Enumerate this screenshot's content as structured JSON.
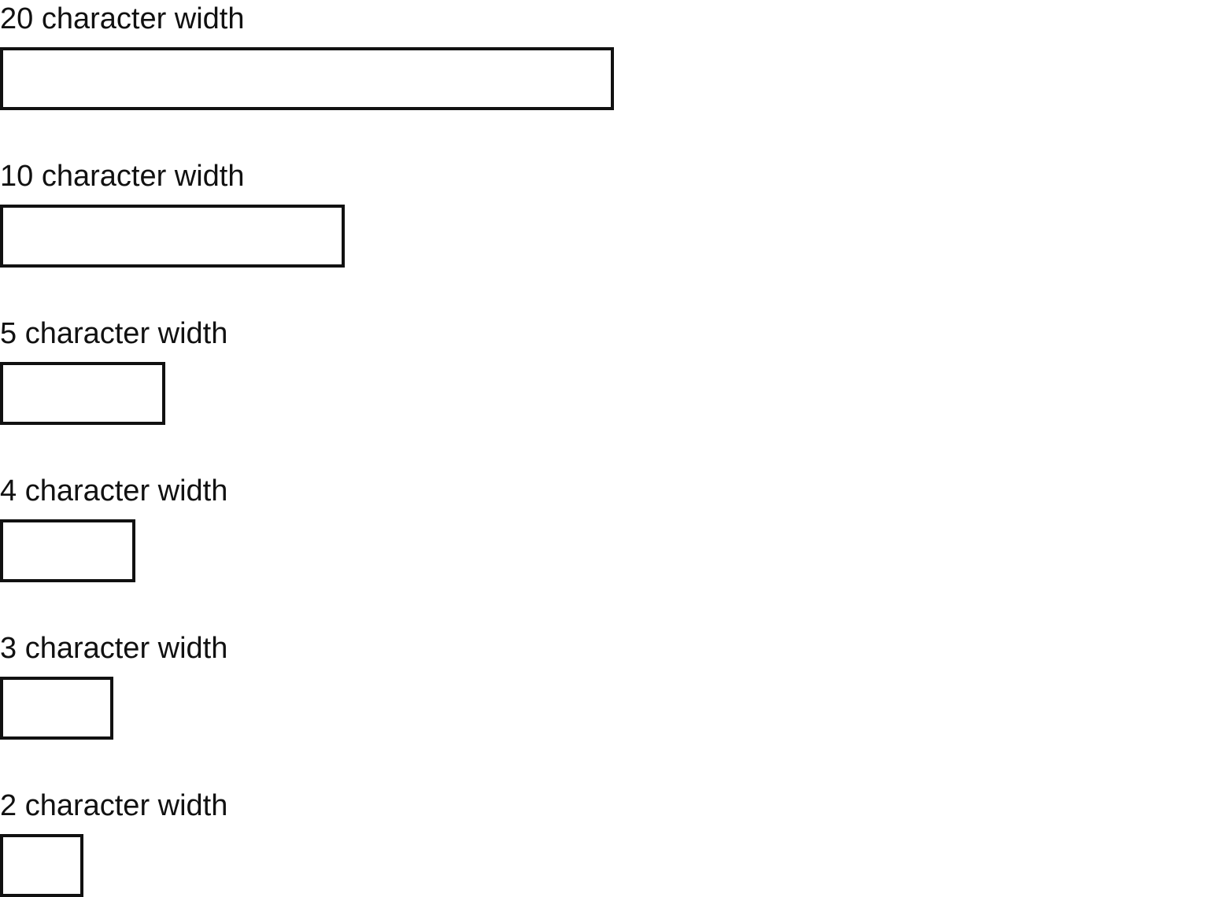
{
  "fields": [
    {
      "label": "20 character width",
      "value": ""
    },
    {
      "label": "10 character width",
      "value": ""
    },
    {
      "label": "5 character width",
      "value": ""
    },
    {
      "label": "4 character width",
      "value": ""
    },
    {
      "label": "3 character width",
      "value": ""
    },
    {
      "label": "2 character width",
      "value": ""
    }
  ]
}
